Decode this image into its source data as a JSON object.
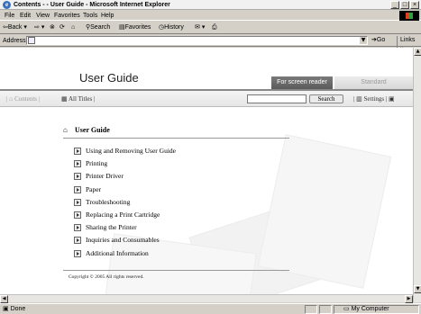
{
  "window": {
    "title": "Contents - - User Guide - Microsoft Internet Explorer",
    "controls": [
      "_",
      "□",
      "×"
    ]
  },
  "menu": [
    "File",
    "Edit",
    "View",
    "Favorites",
    "Tools",
    "Help"
  ],
  "toolbar": {
    "back": "Back",
    "search": "Search",
    "favorites": "Favorites",
    "history": "History"
  },
  "address": {
    "label": "Address",
    "value": "",
    "go": "Go",
    "links": "Links »"
  },
  "header": {
    "title": "User Guide",
    "tab_reader": "For screen reader",
    "tab_standard": "Standard"
  },
  "nav": {
    "contents": "Contents",
    "all_titles": "All Titles",
    "search_button": "Search",
    "settings": "Settings"
  },
  "section": {
    "title": "User Guide",
    "items": [
      "Using and Removing User Guide",
      "Printing",
      "Printer Driver",
      "Paper",
      "Troubleshooting",
      "Replacing a Print Cartridge",
      "Sharing the Printer",
      "Inquiries and Consumables",
      "Additional Information"
    ],
    "copyright": "Copyright © 2005 All rights reserved."
  },
  "status": {
    "text": "Done",
    "zone": "My Computer"
  }
}
